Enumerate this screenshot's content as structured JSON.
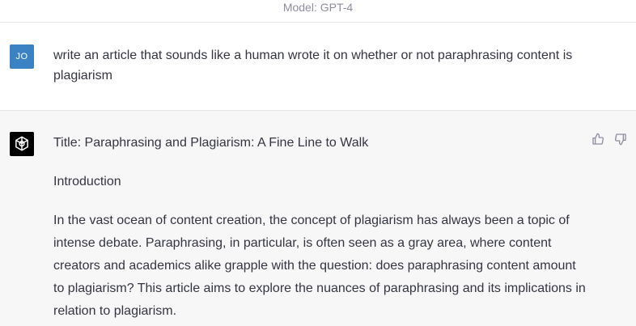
{
  "header": {
    "model_label": "Model: GPT-4"
  },
  "user": {
    "avatar_initials": "JO",
    "avatar_color": "#3b82c4",
    "message": "write an article that sounds like a human wrote it on whether or not paraphrasing content is plagiarism"
  },
  "assistant": {
    "avatar_icon": "openai-logo-icon",
    "title": "Title: Paraphrasing and Plagiarism: A Fine Line to Walk",
    "heading": "Introduction",
    "paragraph": "In the vast ocean of content creation, the concept of plagiarism has always been a topic of intense debate. Paraphrasing, in particular, is often seen as a gray area, where content creators and academics alike grapple with the question: does paraphrasing content amount to plagiarism? This article aims to explore the nuances of paraphrasing and its implications in relation to plagiarism.",
    "feedback_icons": [
      "thumbs-up-icon",
      "thumbs-down-icon"
    ]
  }
}
